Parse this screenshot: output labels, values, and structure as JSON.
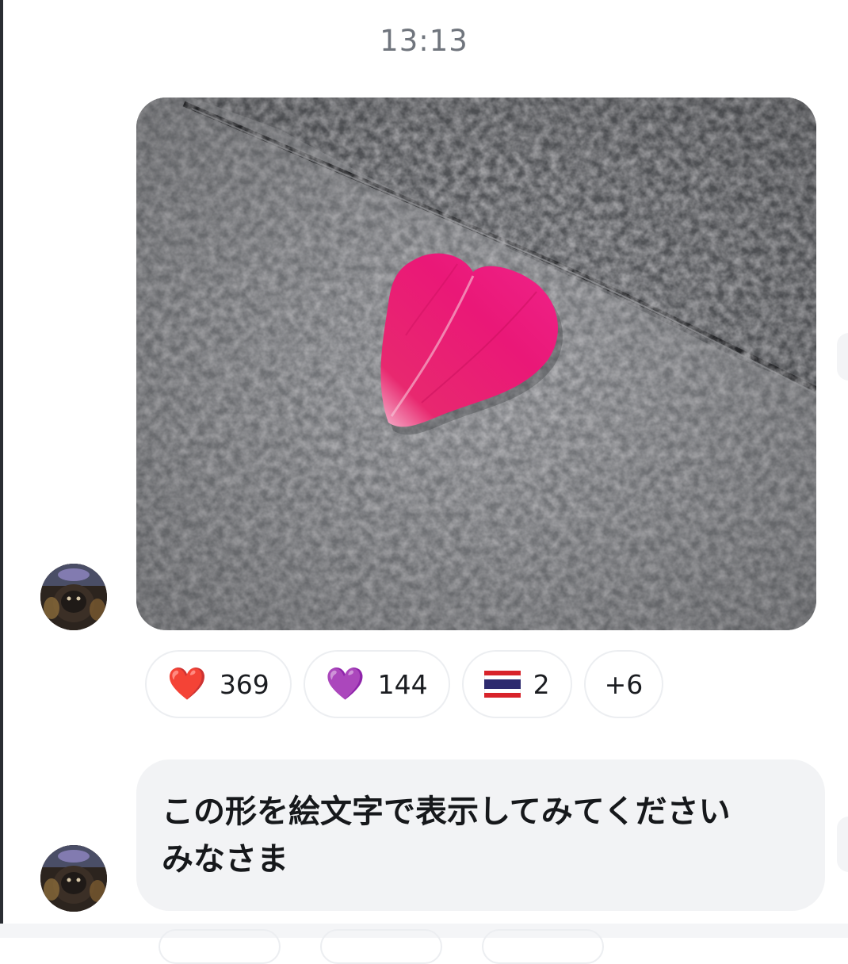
{
  "message_time": "13:13",
  "photo_message": {
    "description_icon": "photo-icon"
  },
  "reactions": [
    {
      "emoji": "❤️",
      "icon": "red-heart-icon",
      "count": "369"
    },
    {
      "emoji": "💜",
      "icon": "purple-heart-icon",
      "count": "144"
    },
    {
      "emoji": "🇹🇭",
      "icon": "thailand-flag-icon",
      "count": "2"
    }
  ],
  "more_reactions": "+6",
  "text_message": {
    "line1": "この形を絵文字で表示してみてください",
    "line2": "みなさま"
  },
  "colors": {
    "bubble_bg": "#f2f3f5",
    "petal": "#e8186f",
    "time_text": "#70757d"
  }
}
